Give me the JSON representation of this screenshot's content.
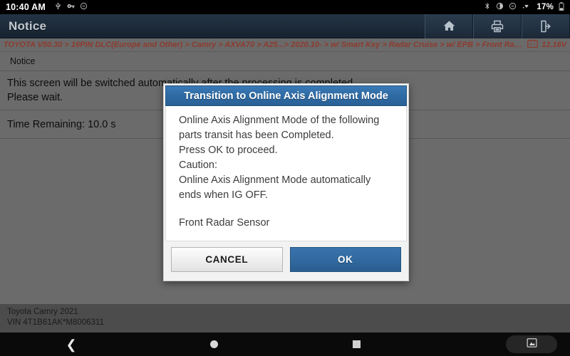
{
  "statusbar": {
    "time": "10:40 AM",
    "left_icons": [
      "usb-icon",
      "vpn-key-icon",
      "do-not-disturb-icon"
    ],
    "right_icons": [
      "bluetooth-icon",
      "brightness-icon",
      "minus-circle-icon",
      "wifi-icon"
    ],
    "battery_percent": "17%"
  },
  "titlebar": {
    "title": "Notice",
    "buttons": [
      {
        "name": "home-button",
        "icon": "home-icon"
      },
      {
        "name": "print-button",
        "icon": "printer-icon"
      },
      {
        "name": "exit-button",
        "icon": "exit-door-icon"
      }
    ]
  },
  "breadcrumb": {
    "path": "TOYOTA V50.30 > 16PIN DLC(Europe and Other) > Camry > AXVA70 > A25...> 2020.10- > w/ Smart Key > Radar Cruise > w/ EPB > Front Radar Sensor",
    "battery_icon": "battery-icon",
    "voltage": "12.16V"
  },
  "content": {
    "section_label": "Notice",
    "message_line1": "This screen will be switched automatically after the processing is completed.",
    "message_line2": "Please wait.",
    "timer_label": "Time Remaining: 10.0 s"
  },
  "dialog": {
    "title": "Transition to Online Axis Alignment Mode",
    "body_line1": "Online Axis Alignment Mode of the following",
    "body_line2": "parts transit has been Completed.",
    "body_line3": "Press OK to proceed.",
    "body_line4": "Caution:",
    "body_line5": "Online Axis Alignment Mode automatically",
    "body_line6": "ends when IG OFF.",
    "body_line7": "Front Radar Sensor",
    "cancel_label": "CANCEL",
    "ok_label": "OK"
  },
  "footer": {
    "vehicle": "Toyota Camry 2021",
    "vin": "VIN 4T1B61AK*M8006311"
  },
  "navbar": {
    "back": "back-icon",
    "home": "home-circle-icon",
    "recents": "recents-square-icon",
    "screenshot": "screenshot-icon"
  },
  "colors": {
    "accent_blue": "#2f6ba4",
    "titlebar": "#1d2b3a",
    "breadcrumb_text": "#8d3b2e",
    "page_bg": "#ffffff"
  }
}
